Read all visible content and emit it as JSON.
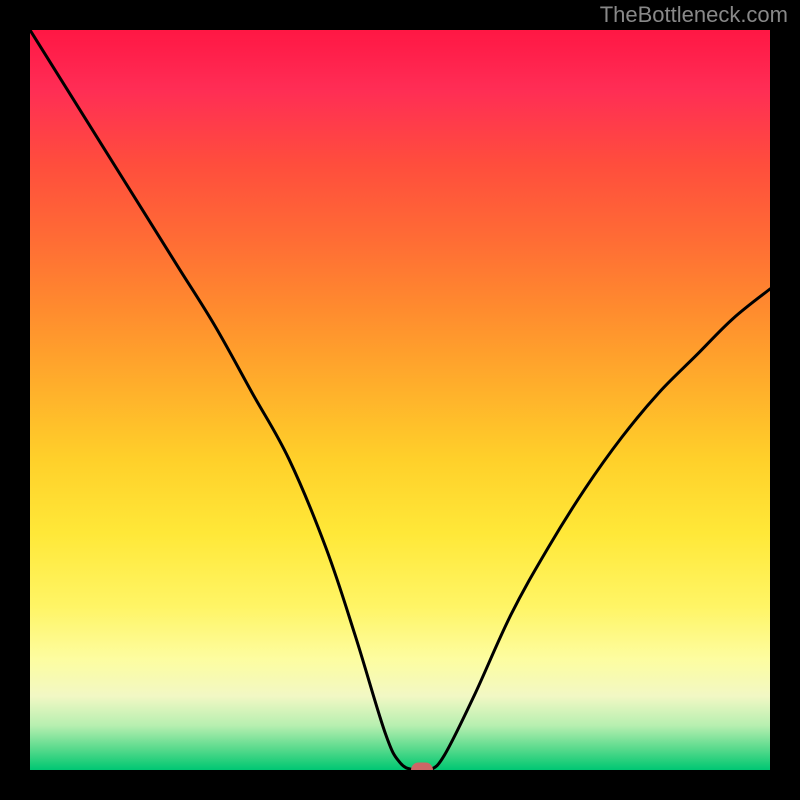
{
  "watermark": "TheBottleneck.com",
  "chart_data": {
    "type": "line",
    "title": "",
    "xlabel": "",
    "ylabel": "",
    "xrange": [
      0,
      100
    ],
    "yrange": [
      0,
      100
    ],
    "background_gradient": {
      "top_color": "#ff1744",
      "bottom_color": "#00c774",
      "meaning": "bottleneck severity (red=high, green=optimal)"
    },
    "series": [
      {
        "name": "bottleneck-curve",
        "x": [
          0,
          5,
          10,
          15,
          20,
          25,
          30,
          35,
          40,
          44,
          48,
          50,
          52,
          54,
          56,
          60,
          65,
          70,
          75,
          80,
          85,
          90,
          95,
          100
        ],
        "values": [
          100,
          92,
          84,
          76,
          68,
          60,
          51,
          42,
          30,
          18,
          5,
          1,
          0,
          0,
          2,
          10,
          21,
          30,
          38,
          45,
          51,
          56,
          61,
          65
        ]
      }
    ],
    "marker": {
      "x": 53,
      "y": 0,
      "color": "#cc6666",
      "meaning": "optimal-point"
    },
    "grid": false,
    "legend": false
  }
}
